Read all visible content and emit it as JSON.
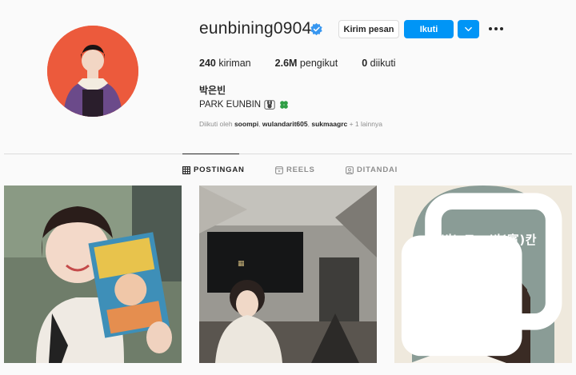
{
  "profile": {
    "username": "eunbining0904",
    "verified": true,
    "full_name": "박은빈",
    "bio": "PARK EUNBIN",
    "bio_icons": [
      "rabbit-icon",
      "clover-icon"
    ],
    "followed_by_prefix": "Diikuti oleh",
    "followed_by_users": [
      "soompi",
      "wulandarit605",
      "sukmaagrc"
    ],
    "followed_by_separator": ", ",
    "followed_by_more": "+ 1 lainnya"
  },
  "actions": {
    "message_label": "Kirim pesan",
    "follow_label": "Ikuti",
    "more_icon": "ellipsis-icon",
    "chevron_icon": "chevron-down-icon"
  },
  "stats": {
    "posts_count": "240",
    "posts_label": "kiriman",
    "followers_count": "2.6M",
    "followers_label": "pengikut",
    "following_count": "0",
    "following_label": "diikuti"
  },
  "tabs": [
    {
      "label": "POSTINGAN",
      "icon": "grid-icon",
      "active": true
    },
    {
      "label": "REELS",
      "icon": "reels-icon",
      "active": false
    },
    {
      "label": "DITANDAI",
      "icon": "tagged-icon",
      "active": false
    }
  ],
  "posts": [
    {
      "type": "photo",
      "overlay_text": ""
    },
    {
      "type": "photo",
      "overlay_text": ""
    },
    {
      "type": "carousel",
      "overlay_text": "은빈노트 : 빈(賓)칸"
    }
  ],
  "colors": {
    "accent": "#0095f6",
    "verified": "#3897f0",
    "avatar_bg": "#ec5a3c"
  }
}
